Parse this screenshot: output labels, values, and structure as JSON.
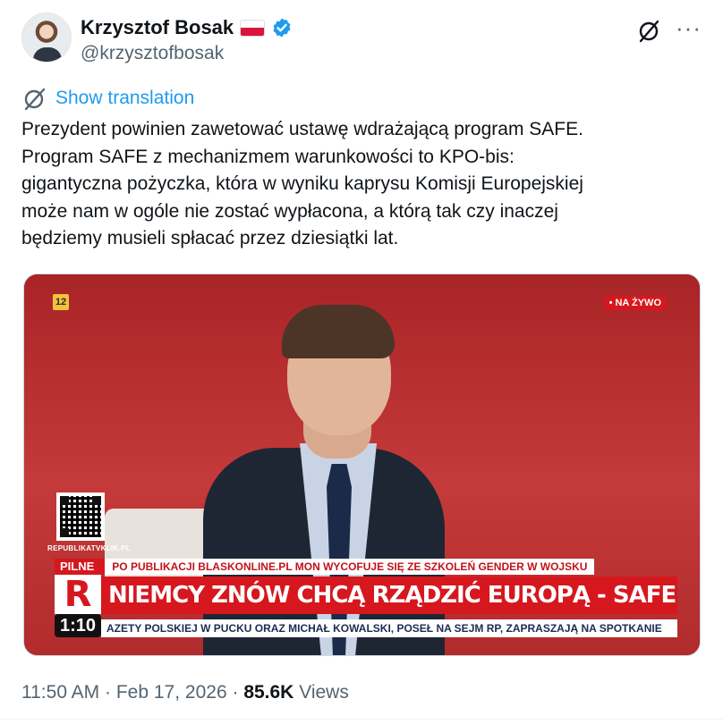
{
  "author": {
    "display_name": "Krzysztof Bosak",
    "handle": "@krzysztofbosak",
    "flag_icon": "poland-flag-icon",
    "verified_icon": "verified-badge-icon",
    "verified_color": "#1d9bf0"
  },
  "actions": {
    "grok_icon": "grok-icon",
    "more_label": "···"
  },
  "translate": {
    "icon": "translate-globe-icon",
    "label": "Show translation"
  },
  "tweet": {
    "lines": [
      "Prezydent powinien zawetować ustawę wdrażającą program SAFE.",
      "Program SAFE z mechanizmem warunkowości to KPO-bis:",
      "gigantyczna pożyczka, która w wyniku kaprysu Komisji Europejskiej",
      "może nam w ogóle nie zostać wypłacona, a którą tak czy inaczej",
      "będziemy musieli spłacać przez dziesiątki lat."
    ]
  },
  "video": {
    "age_rating": "12",
    "live_label": "• NA ŻYWO",
    "qr_label": "REPUBLIKATVKLIK.PL",
    "pilne_label": "PILNE",
    "pilne_text": "PO PUBLIKACJI BLASKONLINE.PL MON WYCOFUJE SIĘ ZE SZKOLEŃ GENDER W WOJSKU",
    "logo_letter": "R",
    "headline": "NIEMCY ZNÓW CHCĄ RZĄDZIĆ EUROPĄ - SAFE JEDNYM Z NARZĘDZI",
    "timer": "1:10",
    "ticker": "AZETY POLSKIEJ W PUCKU ORAZ MICHAŁ KOWALSKI, POSEŁ NA SEJM RP, ZAPRASZAJĄ NA SPOTKANIE",
    "accent_red": "#d6171e"
  },
  "meta": {
    "time": "11:50 AM",
    "separator": "·",
    "date": "Feb 17, 2026",
    "views_count": "85.6K",
    "views_label": "Views"
  }
}
